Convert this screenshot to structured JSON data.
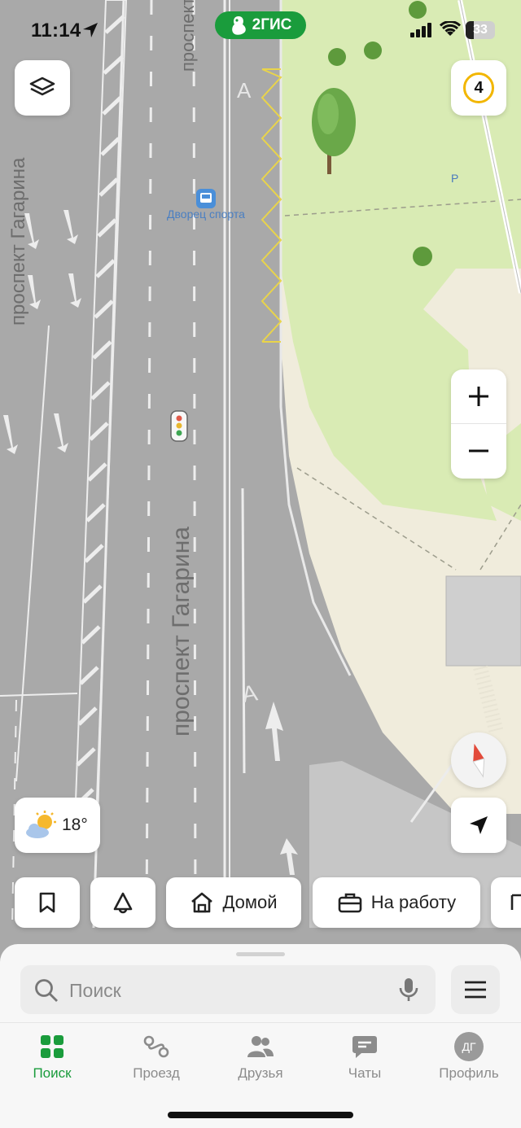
{
  "status_bar": {
    "time": "11:14",
    "battery": "33"
  },
  "app": {
    "brand": "2ГИС"
  },
  "map": {
    "street_labels": [
      "проспект Гагарина",
      "проспект Гагарина",
      "проспект"
    ],
    "poi_label": "Дворец спорта",
    "road_marks": [
      "А",
      "А"
    ],
    "parking_mark": "P",
    "traffic_score": "4"
  },
  "weather": {
    "temperature": "18°"
  },
  "quick_chips": [
    {
      "label": "",
      "icon": "bookmark-icon"
    },
    {
      "label": "",
      "icon": "bell-icon"
    },
    {
      "label": "Домой",
      "icon": "home-icon"
    },
    {
      "label": "На работу",
      "icon": "briefcase-icon"
    }
  ],
  "search": {
    "placeholder": "Поиск"
  },
  "tabs": [
    {
      "label": "Поиск",
      "icon": "grid-icon",
      "active": true
    },
    {
      "label": "Проезд",
      "icon": "route-icon"
    },
    {
      "label": "Друзья",
      "icon": "friends-icon"
    },
    {
      "label": "Чаты",
      "icon": "chat-icon"
    },
    {
      "label": "Профиль",
      "icon": "avatar",
      "initials": "ДГ"
    }
  ],
  "colors": {
    "brand_green": "#1a9c3c",
    "traffic_yellow": "#f2b600",
    "park_green": "#d9ebb4",
    "road_gray": "#a9a9a9"
  }
}
